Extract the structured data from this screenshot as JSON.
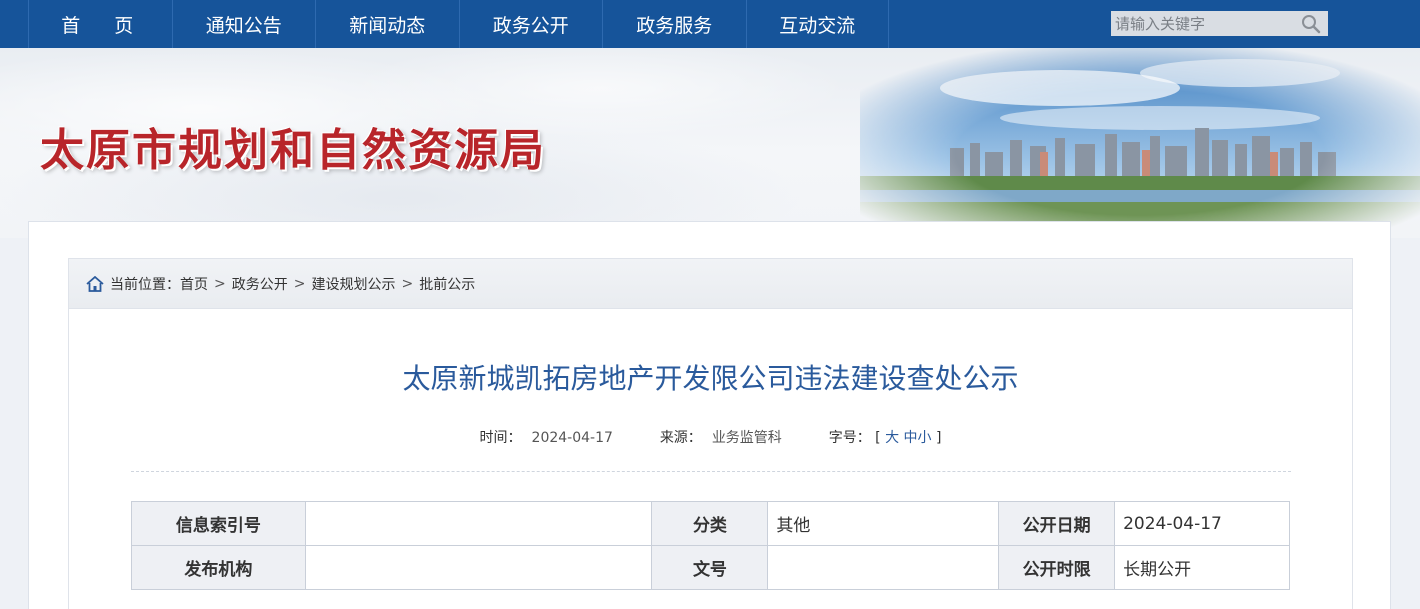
{
  "nav": {
    "items": [
      "首 页",
      "通知公告",
      "新闻动态",
      "政务公开",
      "政务服务",
      "互动交流"
    ],
    "search_placeholder": "请输入关键字"
  },
  "banner": {
    "site_title": "太原市规划和自然资源局"
  },
  "breadcrumb": {
    "prefix": "当前位置：",
    "items": [
      "首页",
      "政务公开",
      "建设规划公示",
      "批前公示"
    ],
    "separator": ">"
  },
  "article": {
    "title": "太原新城凯拓房地产开发限公司违法建设查处公示",
    "time_label": "时间：",
    "time_value": "2024-04-17",
    "source_label": "来源：",
    "source_value": "业务监管科",
    "font_label": "字号：",
    "font_open": "[",
    "font_large": "大",
    "font_medium": "中",
    "font_small": "小",
    "font_close": "]"
  },
  "info_table": {
    "rows": [
      [
        "信息索引号",
        "",
        "分类",
        "其他",
        "公开日期",
        "2024-04-17"
      ],
      [
        "发布机构",
        "",
        "文号",
        "",
        "公开时限",
        "长期公开"
      ]
    ]
  },
  "colors": {
    "nav_bg": "#16549a",
    "title_red": "#b8252a",
    "link_blue": "#2a5a9c"
  }
}
